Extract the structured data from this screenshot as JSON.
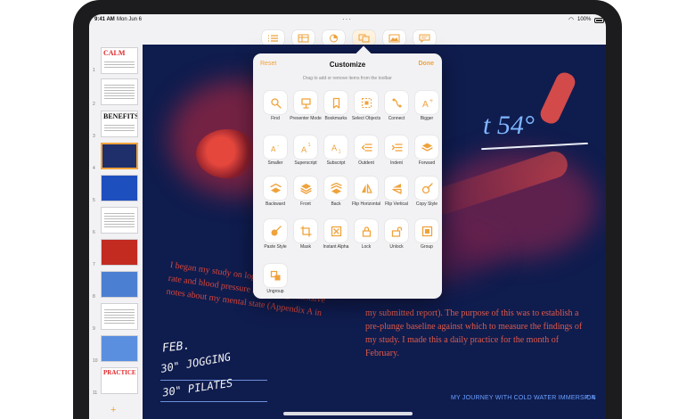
{
  "status": {
    "time": "9:41 AM",
    "date": "Mon Jun 6",
    "battery": "100%"
  },
  "toolbar": {
    "buttons": [
      {
        "name": "list-view-button",
        "icon": "list-icon"
      },
      {
        "name": "table-button",
        "icon": "table-icon"
      },
      {
        "name": "chart-button",
        "icon": "chart-icon"
      },
      {
        "name": "shape-button",
        "icon": "shape-icon"
      },
      {
        "name": "media-button",
        "icon": "image-icon"
      },
      {
        "name": "comment-button",
        "icon": "comment-icon"
      }
    ]
  },
  "sidebar": {
    "slides": [
      {
        "num": "1",
        "title": "CALM"
      },
      {
        "num": "2",
        "title": ""
      },
      {
        "num": "3",
        "title": "BENEFITS"
      },
      {
        "num": "4",
        "title": ""
      },
      {
        "num": "5",
        "title": ""
      },
      {
        "num": "6",
        "title": ""
      },
      {
        "num": "7",
        "title": ""
      },
      {
        "num": "8",
        "title": ""
      },
      {
        "num": "9",
        "title": ""
      },
      {
        "num": "10",
        "title": ""
      },
      {
        "num": "11",
        "title": "PRACTICE"
      }
    ],
    "add_label": "+"
  },
  "popover": {
    "reset": "Reset",
    "title": "Customize",
    "done": "Done",
    "subtitle": "Drag to add or remove items from the toolbar",
    "items": [
      {
        "label": "Find",
        "icon": "magnifier-icon"
      },
      {
        "label": "Presenter Mode",
        "icon": "presenter-icon"
      },
      {
        "label": "Bookmarks",
        "icon": "bookmark-icon"
      },
      {
        "label": "Select Objects",
        "icon": "select-objects-icon"
      },
      {
        "label": "Connect",
        "icon": "connect-icon"
      },
      {
        "label": "Bigger",
        "icon": "text-bigger-icon"
      },
      {
        "label": "Smaller",
        "icon": "text-smaller-icon"
      },
      {
        "label": "Superscript",
        "icon": "superscript-icon"
      },
      {
        "label": "Subscript",
        "icon": "subscript-icon"
      },
      {
        "label": "Outdent",
        "icon": "outdent-icon"
      },
      {
        "label": "Indent",
        "icon": "indent-icon"
      },
      {
        "label": "Forward",
        "icon": "forward-icon"
      },
      {
        "label": "Backward",
        "icon": "backward-icon"
      },
      {
        "label": "Front",
        "icon": "front-icon"
      },
      {
        "label": "Back",
        "icon": "back-icon"
      },
      {
        "label": "Flip Horizontal",
        "icon": "flip-horizontal-icon"
      },
      {
        "label": "Flip Vertical",
        "icon": "flip-vertical-icon"
      },
      {
        "label": "Copy Style",
        "icon": "copy-style-icon"
      },
      {
        "label": "Paste Style",
        "icon": "paste-style-icon"
      },
      {
        "label": "Mask",
        "icon": "mask-icon"
      },
      {
        "label": "Instant Alpha",
        "icon": "instant-alpha-icon"
      },
      {
        "label": "Lock",
        "icon": "lock-icon"
      },
      {
        "label": "Unlock",
        "icon": "unlock-icon"
      },
      {
        "label": "Group",
        "icon": "group-icon"
      },
      {
        "label": "Ungroup",
        "icon": "ungroup-icon"
      }
    ]
  },
  "slide": {
    "title_fragment": "t 54°",
    "body_left": "I began my study on logging biometric data heart rate and blood pressure and taking extensive notes about my mental state (Appendix A in",
    "body_right": "my submitted report). The purpose of this was to establish a pre-plunge baseline against which to measure the findings of my study. I made this a daily practice for the month of February.",
    "handwriting": [
      "FEB.",
      "30\" JOGGING",
      "30\" PILATES"
    ],
    "footer_caption": "MY JOURNEY WITH COLD WATER IMMERSION",
    "footer_page": "P. 4"
  },
  "colors": {
    "accent": "#f0a23b",
    "slide_bg": "#0f1c4e",
    "slide_text": "#e05a4a"
  }
}
